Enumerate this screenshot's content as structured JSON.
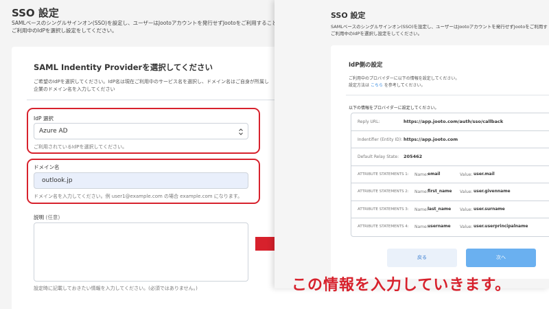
{
  "left": {
    "title": "SSO 設定",
    "desc_line1": "SAMLベースのシングルサインオン(SSO)を設定し、ユーザーはJootoアカウントを発行せずJootoをご利用することが",
    "desc_line2": "ご利用中のIdPを選択し設定をしてください。",
    "card_title": "SAML Indentity Providerを選択してください",
    "card_desc_line1": "ご希望のIdPを選択してください。IdP名は現在ご利用中のサービス名を選択し、ドメイン名はご自身が所属し",
    "card_desc_line2": "企業のドメイン名を入力してください",
    "idp_label": "IdP 選択",
    "idp_value": "Azure AD",
    "idp_hint": "ご利用されているIdPを選択してください。",
    "domain_label": "ドメイン名",
    "domain_value": "outlook.jp",
    "domain_hint": "ドメイン名を入力してください。例 user1@example.com の場合 example.com になります。",
    "desc_label": "説明",
    "desc_optional": "(任意)",
    "desc_hint": "設定時に記載しておきたい情報を入力してください。(必須ではありません。)"
  },
  "right": {
    "title": "SSO 設定",
    "desc_line1": "SAMLベースのシングルサインオン(SSO)を設定し、ユーザーはJootoアカウントを発行せずJootoをご利用す",
    "desc_line2": "ご利用中のIdPを選択し設定をしてください。",
    "card_title": "IdP側の設定",
    "card_desc_line1": "ご利用中のプロバイダーに以下の情報を設定してください。",
    "card_desc_line2_pre": "設定方法は",
    "card_desc_link": "こちら",
    "card_desc_line2_post": "を参考してください。",
    "table_intro": "以下の情報をプロバイダーに設定してください。",
    "rows": [
      {
        "key": "Reply URL:",
        "value": "https://app.jooto.com/auth/sso/callback"
      },
      {
        "key": "Indentifier (Entity ID):",
        "value": "https://app.jooto.com"
      },
      {
        "key": "Default Relay State:",
        "value": "205462"
      }
    ],
    "attrs": [
      {
        "key": "ATTRIBUTE STATEMENTS 1:",
        "name_label": "Name:",
        "name": "email",
        "value_label": "Value:",
        "value": "user.mail"
      },
      {
        "key": "ATTRIBUTE STATEMENTS 2:",
        "name_label": "Name:",
        "name": "first_name",
        "value_label": "Value:",
        "value": "user.givenname"
      },
      {
        "key": "ATTRIBUTE STATEMENTS 3:",
        "name_label": "Name:",
        "name": "last_name",
        "value_label": "Value:",
        "value": "user.surname"
      },
      {
        "key": "ATTRIBUTE STATEMENTS 4:",
        "name_label": "Name:",
        "name": "username",
        "value_label": "Value:",
        "value": "user.userprincipalname"
      }
    ],
    "back_label": "戻る",
    "next_label": "次へ"
  },
  "caption": "この情報を入力していきます。",
  "colors": {
    "highlight": "#d7212c",
    "link": "#3a8be0",
    "primary_button": "#6ab0f0"
  }
}
